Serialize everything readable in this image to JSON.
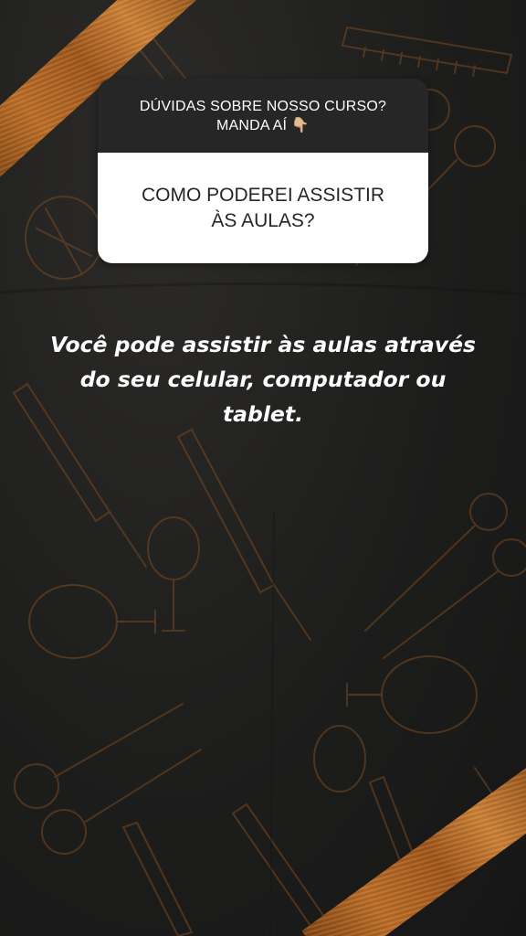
{
  "question_box": {
    "prompt_line1": "DÚVIDAS SOBRE NOSSO CURSO?",
    "prompt_line2": "MANDA AÍ 👇🏼",
    "question_line1": "COMO PODEREI ASSISTIR",
    "question_line2": "ÀS AULAS?"
  },
  "answer": {
    "line1": "Você pode assistir às aulas através",
    "line2": "do seu celular, computador ou",
    "line3": "tablet."
  },
  "colors": {
    "background": "#1f1f1f",
    "tape": "#c7752a",
    "illustration_stroke": "#7a4a22",
    "question_header": "#262626",
    "question_body": "#ffffff"
  }
}
